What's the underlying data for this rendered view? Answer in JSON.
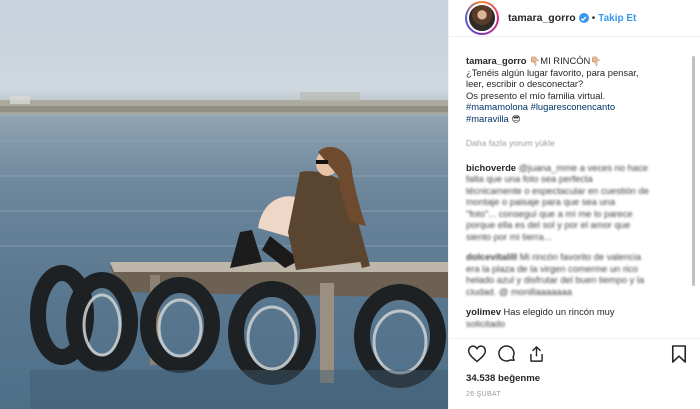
{
  "photo": {
    "alt": ""
  },
  "header": {
    "username": "tamara_gorro",
    "separator": "•",
    "follow_label": "Takip Et"
  },
  "caption": {
    "username": "tamara_gorro",
    "title": "MI RINCÓN",
    "lines": [
      "¿Tenéis algún lugar favorito, para pensar,",
      "leer, escribir o desconectar?",
      "Os presento el mío familia virtual."
    ],
    "hashtags_line1": "#mamamolona #lugaresconencanto",
    "hashtags_line2": "#maravilla"
  },
  "load_more": "Daha fazla yorum yükle",
  "comments": [
    {
      "username": "bichoverde",
      "lines": [
        "@juana_mme a veces no hace",
        "falta que una foto sea perfecta",
        "técnicamente o espectacular en cuestión de",
        "montaje o paisaje para que sea una",
        "\"foto\"... conseguí que a mí me lo parece",
        "porque ella es del sol y por el amor que",
        "siento por mi tierra..."
      ],
      "blurred_from": 0
    },
    {
      "username": "dolcevitalill",
      "lines": [
        "Mi rincón favorito de valencia",
        "era la plaza de la virgen comerme un rico",
        "helado azul y disfrutar del buen tiempo y la",
        "ciudad. @ monillaaaaaaa"
      ],
      "blurred_from": 0
    },
    {
      "username": "yolimev",
      "lines": [
        "Has elegido un rincón muy",
        "solicitado"
      ],
      "blurred_from": 1
    }
  ],
  "likes": "34.538 beğenme",
  "date": "26 ŞUBAT",
  "colors": {
    "accent": "#3897f0",
    "text": "#262626",
    "hashtag": "#003569",
    "muted": "#999999"
  },
  "icons": [
    "heart-icon",
    "comment-icon",
    "share-icon",
    "bookmark-icon",
    "verified-badge-icon"
  ]
}
